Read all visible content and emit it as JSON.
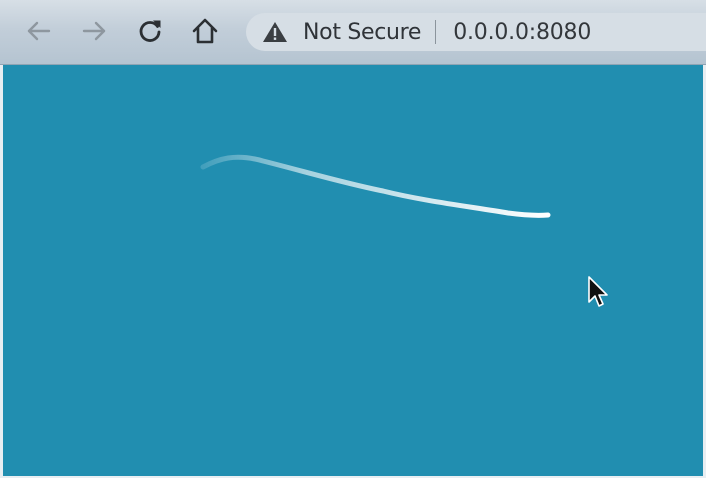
{
  "browser": {
    "back_icon": "arrow-left-icon",
    "forward_icon": "arrow-right-icon",
    "reload_icon": "reload-icon",
    "home_icon": "home-icon",
    "security_icon": "warning-triangle-icon",
    "security_label": "Not Secure",
    "url": "0.0.0.0:8080"
  },
  "page": {
    "background_color": "#218eb0",
    "stroke_color": "#ffffff",
    "cursor_icon": "mouse-pointer-icon"
  }
}
